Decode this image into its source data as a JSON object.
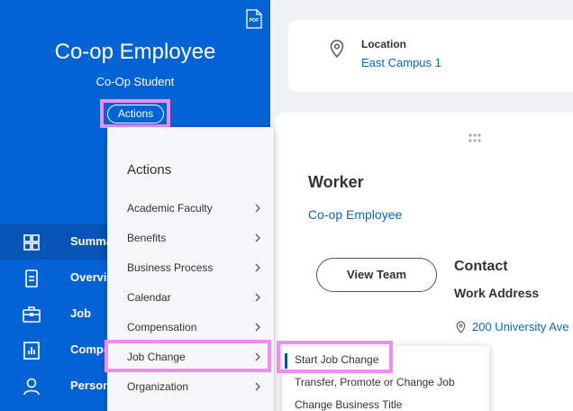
{
  "header": {
    "employee_name": "Co-op Employee",
    "employee_title": "Co-Op Student",
    "actions_label": "Actions",
    "pdf_icon": "PDF"
  },
  "nav": {
    "items": [
      {
        "label": "Summa",
        "icon": "summary-grid-icon",
        "active": true
      },
      {
        "label": "Overvi",
        "icon": "overview-doc-icon"
      },
      {
        "label": "Job",
        "icon": "job-briefcase-icon"
      },
      {
        "label": "Compe",
        "icon": "compensation-chart-icon"
      },
      {
        "label": "Person",
        "icon": "person-icon"
      }
    ]
  },
  "location": {
    "label": "Location",
    "value": "East Campus 1"
  },
  "worker": {
    "heading": "Worker",
    "name": "Co-op Employee",
    "view_team": "View Team",
    "contact_heading": "Contact",
    "work_address_heading": "Work Address",
    "address": "200 University Ave"
  },
  "actions_menu": {
    "title": "Actions",
    "items": [
      "Academic Faculty",
      "Benefits",
      "Business Process",
      "Calendar",
      "Compensation",
      "Job Change",
      "Organization"
    ]
  },
  "job_change_submenu": {
    "items": [
      "Start Job Change",
      "Transfer, Promote or Change Job",
      "Change Business Title"
    ]
  },
  "colors": {
    "brand_blue": "#0463d4",
    "link_blue": "#0b69b7",
    "highlight": "#f08cf2"
  }
}
